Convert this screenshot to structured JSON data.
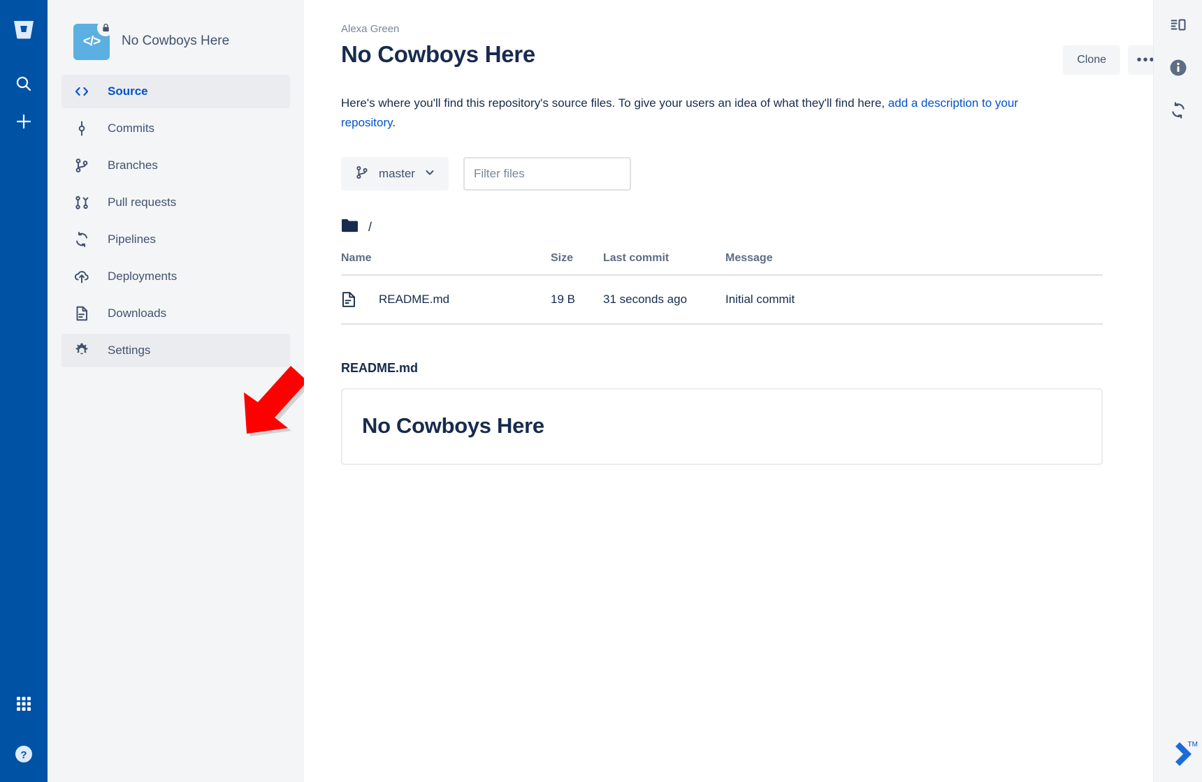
{
  "global_nav": {
    "logo_icon": "bitbucket-logo-icon",
    "items": [
      {
        "name": "search",
        "icon": "search-icon"
      },
      {
        "name": "create",
        "icon": "plus-icon"
      }
    ],
    "bottom_items": [
      {
        "name": "app-switcher",
        "icon": "grid-icon"
      },
      {
        "name": "help",
        "icon": "question-circle-icon"
      }
    ]
  },
  "sidebar": {
    "repo_name": "No Cowboys Here",
    "repo_avatar_glyph": "</>",
    "repo_avatar_color": "#5BAFE1",
    "lock_icon": "lock-icon",
    "items": [
      {
        "label": "Source",
        "icon": "code-icon",
        "state": "active"
      },
      {
        "label": "Commits",
        "icon": "commit-icon",
        "state": "normal"
      },
      {
        "label": "Branches",
        "icon": "branch-icon",
        "state": "normal"
      },
      {
        "label": "Pull requests",
        "icon": "pull-request-icon",
        "state": "normal"
      },
      {
        "label": "Pipelines",
        "icon": "pipelines-icon",
        "state": "normal"
      },
      {
        "label": "Deployments",
        "icon": "deployments-icon",
        "state": "normal"
      },
      {
        "label": "Downloads",
        "icon": "downloads-icon",
        "state": "normal"
      },
      {
        "label": "Settings",
        "icon": "gear-icon",
        "state": "highlighted"
      }
    ]
  },
  "header": {
    "breadcrumb": "Alexa Green",
    "title": "No Cowboys Here",
    "clone_label": "Clone",
    "more_label": "•••"
  },
  "description": {
    "text_before": "Here's where you'll find this repository's source files. To give your users an idea of what they'll find here, ",
    "link_text": "add a description to your repository",
    "text_after": "."
  },
  "controls": {
    "branch": "master",
    "branch_icon": "branch-icon",
    "chevron_icon": "chevron-down-icon",
    "filter_placeholder": "Filter files",
    "filter_value": ""
  },
  "browser": {
    "path": "/",
    "folder_icon": "folder-icon",
    "columns": [
      "Name",
      "Size",
      "Last commit",
      "Message"
    ],
    "rows": [
      {
        "icon": "file-icon",
        "name": "README.md",
        "size": "19 B",
        "last_commit": "31 seconds ago",
        "message": "Initial commit"
      }
    ]
  },
  "readme": {
    "label": "README.md",
    "heading": "No Cowboys Here"
  },
  "right_rail": {
    "items": [
      {
        "name": "sidebar-toggle",
        "icon": "panel-toggle-icon"
      },
      {
        "name": "info",
        "icon": "info-circle-icon"
      },
      {
        "name": "refresh",
        "icon": "sync-icon"
      }
    ],
    "atlassian_logo": "atlassian-logo-icon",
    "trademark": "TM"
  },
  "annotation": {
    "arrow_color": "#FF0000",
    "points_at": "Settings"
  },
  "colors": {
    "rail_blue": "#0052A5",
    "link_blue": "#0052CC",
    "sidebar_bg": "#F4F5F7",
    "text_dark": "#172B4D",
    "text_muted": "#42526E",
    "text_subtle": "#7A869A"
  }
}
